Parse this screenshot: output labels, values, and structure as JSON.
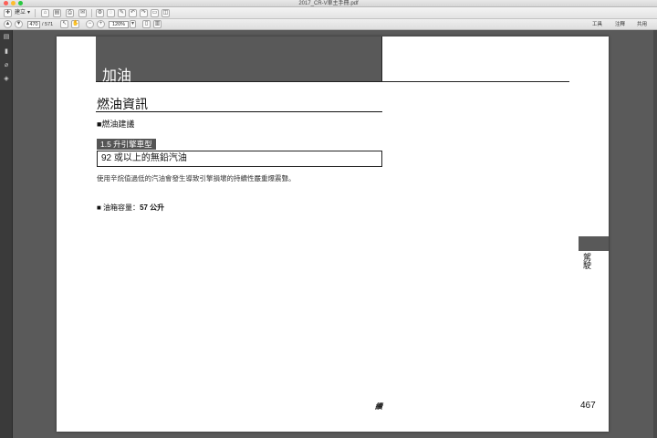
{
  "window": {
    "title": "2017_CR-V車主手冊.pdf"
  },
  "toolbar1": {
    "create_label": "建立",
    "icons": [
      "create-icon",
      "open-icon",
      "save-icon",
      "print-icon",
      "email-icon",
      "gear-icon",
      "comment-icon",
      "highlight-icon",
      "undo-icon",
      "redo-icon",
      "fit-icon",
      "fullscreen-icon"
    ]
  },
  "toolbar2": {
    "page_current": "470",
    "page_total": "/ 571",
    "zoom": "120%",
    "tools_label": "工具",
    "comment_label": "注釋",
    "share_label": "共用"
  },
  "document": {
    "chapter_title": "加油",
    "section_title": "燃油資訊",
    "sub_title": "■燃油建議",
    "engine_tag": "1.5 升引擎車型",
    "fuel_recommendation": "92 或以上的無鉛汽油",
    "note": "使用辛烷值過低的汽油會發生導致引擎損壞的持續性嚴重爆震聲。",
    "capacity_label": "■  油箱容量：",
    "capacity_value": "57 公升",
    "side_label": "駕駛",
    "footer_cont": "續",
    "page_number": "467"
  }
}
